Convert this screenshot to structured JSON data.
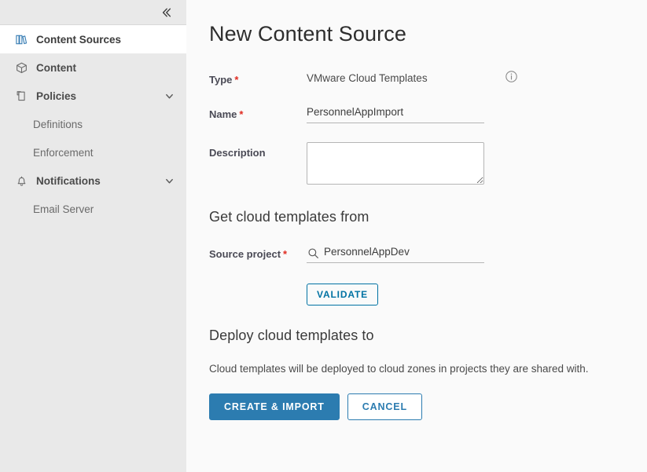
{
  "sidebar": {
    "collapse_icon": "chevron-double-left-icon",
    "items": [
      {
        "label": "Content Sources",
        "icon": "library-icon",
        "selected": true,
        "expandable": false,
        "sub": false
      },
      {
        "label": "Content",
        "icon": "cube-icon",
        "selected": false,
        "expandable": false,
        "sub": false
      },
      {
        "label": "Policies",
        "icon": "policy-document-icon",
        "selected": false,
        "expandable": true,
        "sub": false
      },
      {
        "label": "Definitions",
        "icon": "",
        "selected": false,
        "expandable": false,
        "sub": true
      },
      {
        "label": "Enforcement",
        "icon": "",
        "selected": false,
        "expandable": false,
        "sub": true
      },
      {
        "label": "Notifications",
        "icon": "bell-icon",
        "selected": false,
        "expandable": true,
        "sub": false
      },
      {
        "label": "Email Server",
        "icon": "",
        "selected": false,
        "expandable": false,
        "sub": true
      }
    ]
  },
  "main": {
    "title": "New Content Source",
    "fields": {
      "type": {
        "label": "Type",
        "required_marker": "*",
        "value": "VMware Cloud Templates",
        "info_icon": "info-circle-icon"
      },
      "name": {
        "label": "Name",
        "required_marker": "*",
        "value": "PersonnelAppImport",
        "placeholder": ""
      },
      "description": {
        "label": "Description",
        "required_marker": "",
        "value": "",
        "placeholder": ""
      },
      "source_project": {
        "label": "Source project",
        "required_marker": "*",
        "value": "PersonnelAppDev",
        "placeholder": "",
        "icon": "search-icon"
      }
    },
    "sections": {
      "get_from": "Get cloud templates from",
      "deploy_to": "Deploy cloud templates to"
    },
    "validate_label": "VALIDATE",
    "deploy_helper": "Cloud templates will be deployed to cloud zones in projects they are shared with.",
    "primary_action": "CREATE & IMPORT",
    "secondary_action": "CANCEL"
  },
  "colors": {
    "accent_blue": "#2c7cb0",
    "link_blue": "#0072a3",
    "required_red": "#e02b20",
    "sidebar_bg": "#e9e9e9",
    "main_bg": "#fafafa"
  }
}
